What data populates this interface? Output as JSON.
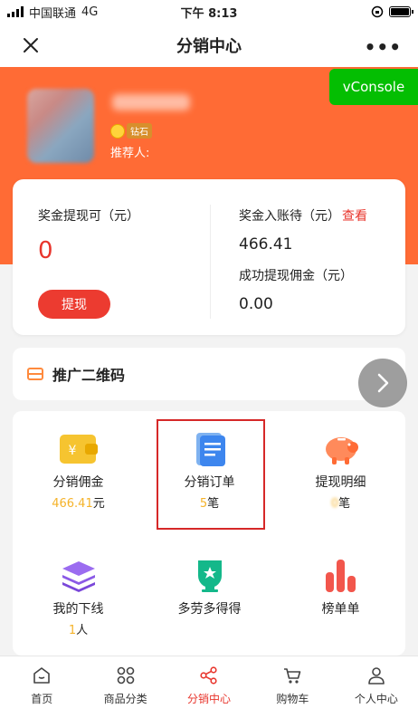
{
  "status_bar": {
    "carrier": "中国联通",
    "network": "4G",
    "time": "下午 8:13"
  },
  "nav": {
    "title": "分销中心"
  },
  "profile": {
    "level": "钻石",
    "referrer_label": "推荐人:"
  },
  "vconsole_label": "vConsole",
  "earnings": {
    "withdrawable_label": "奖金提现可（元）",
    "withdrawable_value": "0",
    "withdraw_button": "提现",
    "pending_label": "奖金入账待（元）",
    "view_link": "查看",
    "pending_value": "466.41",
    "success_label": "成功提现佣金（元）",
    "success_value": "0.00"
  },
  "qr": {
    "label": "推广二维码"
  },
  "menu": {
    "commission": {
      "title": "分销佣金",
      "value": "466.41",
      "unit": "元"
    },
    "orders": {
      "title": "分销订单",
      "value": "5",
      "unit": "笔"
    },
    "withdraw_detail": {
      "title": "提现明细",
      "value": "0",
      "unit": "笔"
    },
    "downline": {
      "title": "我的下线",
      "value": "1",
      "unit": "人"
    },
    "more_work": {
      "title": "多劳多得得"
    },
    "ranking": {
      "title": "榜单单"
    }
  },
  "tabs": [
    {
      "label": "首页",
      "icon": "home-icon"
    },
    {
      "label": "商品分类",
      "icon": "category-icon"
    },
    {
      "label": "分销中心",
      "icon": "share-icon",
      "active": true
    },
    {
      "label": "购物车",
      "icon": "cart-icon"
    },
    {
      "label": "个人中心",
      "icon": "user-icon"
    }
  ],
  "colors": {
    "brand_orange": "#ff6b35",
    "accent_red": "#e8352c",
    "vconsole_green": "#04be02",
    "amount_gold": "#f5b32a"
  }
}
